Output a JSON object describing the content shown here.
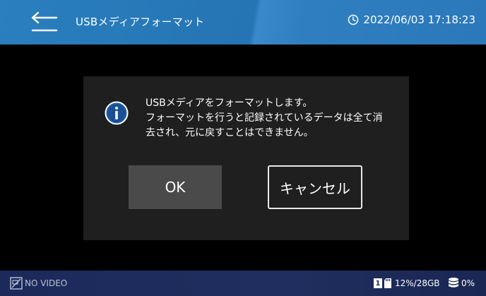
{
  "header": {
    "title": "USBメディアフォーマット",
    "datetime": "2022/06/03 17:18:23",
    "back_icon": "back-arrow-icon",
    "clock_icon": "clock-icon"
  },
  "dialog": {
    "icon": "info-icon",
    "message_line1": "USBメディアをフォーマットします。",
    "message_line2": "フォーマットを行うと記録されているデータは全て消",
    "message_line3": "去され、元に戻すことはできません。",
    "ok_label": "OK",
    "cancel_label": "キャンセル"
  },
  "footer": {
    "video_icon": "no-video-icon",
    "video_status": "NO VIDEO",
    "slot_number": "1",
    "storage_status": "12%/28GB",
    "db_icon": "database-icon",
    "db_status": "0%"
  },
  "colors": {
    "header_bg": "#2a7fbe",
    "footer_bg": "#1b2a5a",
    "dialog_bg": "#1f1f1f",
    "ok_bg": "#4a4a4a"
  }
}
